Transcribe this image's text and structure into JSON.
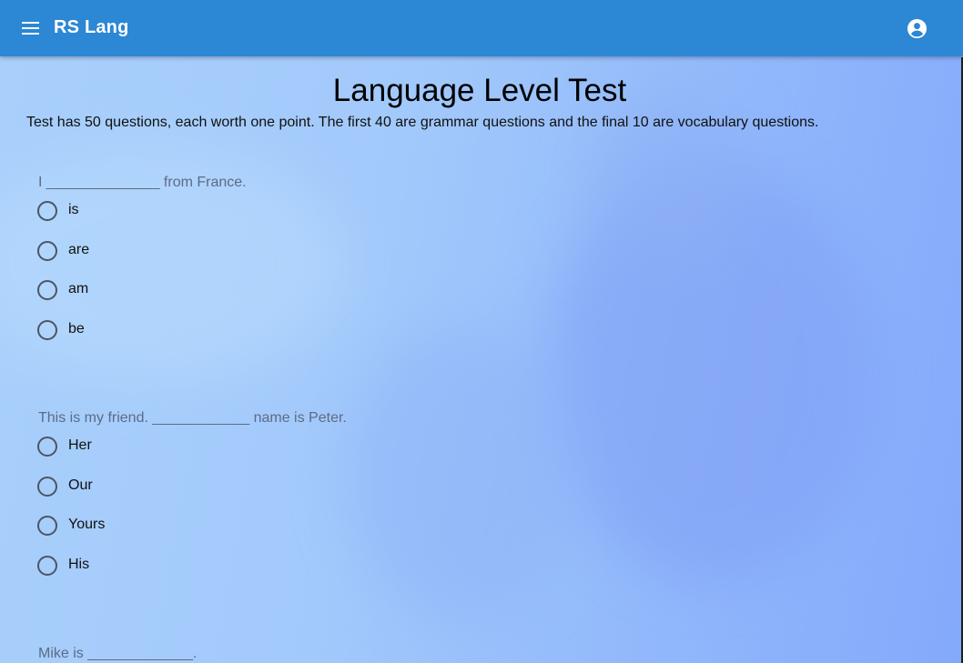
{
  "app": {
    "title": "RS Lang"
  },
  "test": {
    "title": "Language Level Test",
    "description": "Test has 50 questions, each worth one point. The first 40 are grammar questions and the final 10 are vocabulary questions."
  },
  "questions": [
    {
      "text": "I ______________ from France.",
      "options": [
        "is",
        "are",
        "am",
        "be"
      ]
    },
    {
      "text": "This is my friend. ____________ name is Peter.",
      "options": [
        "Her",
        "Our",
        "Yours",
        "His"
      ]
    },
    {
      "text": "Mike is _____________."
    }
  ],
  "colors": {
    "appbar": "#2c87d4",
    "question_text": "#5d6b85",
    "radio_border": "#4b5565"
  },
  "icons": {
    "menu": "menu-icon",
    "account": "account-circle-icon"
  }
}
